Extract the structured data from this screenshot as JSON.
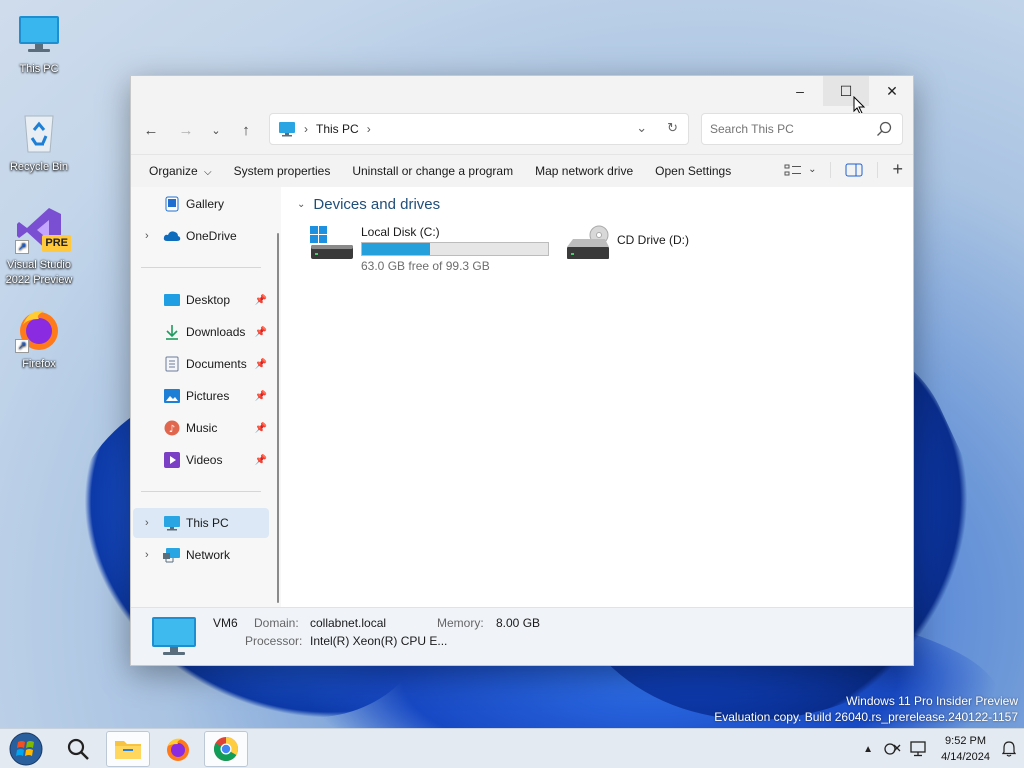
{
  "desktop": {
    "icons": [
      {
        "label": "This PC"
      },
      {
        "label": "Recycle Bin"
      },
      {
        "label": "Visual Studio 2022 Preview",
        "badge": "PRE"
      },
      {
        "label": "Firefox"
      }
    ]
  },
  "window": {
    "controls": {
      "minimize": "–",
      "maximize": "☐",
      "close": "✕"
    },
    "address": {
      "location": "This PC",
      "sep": "›"
    },
    "search": {
      "placeholder": "Search This PC"
    },
    "toolbar": {
      "items": [
        "Organize",
        "System properties",
        "Uninstall or change a program",
        "Map network drive",
        "Open Settings"
      ],
      "organize_chevron": "⌵"
    },
    "sidebar": {
      "top": [
        {
          "label": "Gallery"
        },
        {
          "label": "OneDrive"
        }
      ],
      "quick": [
        {
          "label": "Desktop"
        },
        {
          "label": "Downloads"
        },
        {
          "label": "Documents"
        },
        {
          "label": "Pictures"
        },
        {
          "label": "Music"
        },
        {
          "label": "Videos"
        }
      ],
      "bottom": [
        {
          "label": "This PC"
        },
        {
          "label": "Network"
        }
      ]
    },
    "content": {
      "group": "Devices and drives",
      "drives": [
        {
          "name": "Local Disk (C:)",
          "free": "63.0 GB free of 99.3 GB",
          "used_fraction": 0.366
        },
        {
          "name": "CD Drive (D:)"
        }
      ]
    },
    "details": {
      "computer": "VM6",
      "domain_label": "Domain:",
      "domain": "collabnet.local",
      "memory_label": "Memory:",
      "memory": "8.00 GB",
      "processor_label": "Processor:",
      "processor": "Intel(R) Xeon(R) CPU E..."
    }
  },
  "watermark": {
    "line1": "Windows 11 Pro Insider Preview",
    "line2": "Evaluation copy. Build 26040.rs_prerelease.240122-1157"
  },
  "taskbar": {
    "time": "9:52 PM",
    "date": "4/14/2024"
  },
  "colors": {
    "accent": "#26a0da",
    "selection": "#dce8f5"
  }
}
